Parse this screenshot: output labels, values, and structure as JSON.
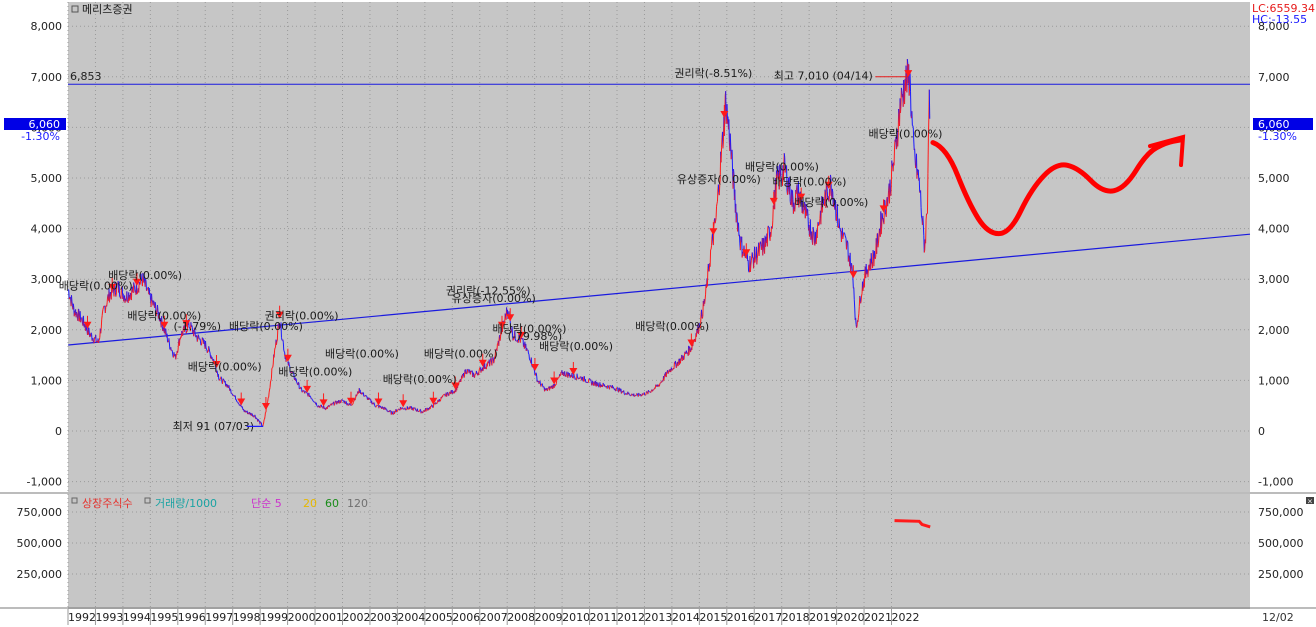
{
  "panel_title": "메리츠증권",
  "readouts": {
    "lc": "LC:6559.34",
    "hc": "HC:-13.55"
  },
  "current_price": {
    "value": "6,060",
    "change": "-1.30%"
  },
  "colors": {
    "price_up": "#ff1a1a",
    "price_down": "#1a1aff",
    "trendline": "#1a1adf",
    "marker": "#ff1a1a",
    "current_box": "#0000e6",
    "overlay": "#ff0000"
  },
  "volume_panel": {
    "legend": [
      {
        "text": "상장주식수",
        "color": "#e6322d"
      },
      {
        "text": "거래량/1000",
        "color": "#1aa3a3"
      },
      {
        "text": "단순 5",
        "color": "#cc33cc"
      },
      {
        "text": "20",
        "color": "#e6b800"
      },
      {
        "text": "60",
        "color": "#1a8c1a"
      },
      {
        "text": "120",
        "color": "#707070"
      }
    ]
  },
  "chart_data": [
    {
      "type": "line",
      "title": "메리츠증권",
      "y_ticks": [
        "8,000",
        "7,000",
        "6,000",
        "5,000",
        "4,000",
        "3,000",
        "2,000",
        "1,000",
        "0",
        "-1,000"
      ],
      "y_tick_values": [
        8000,
        7000,
        6000,
        5000,
        4000,
        3000,
        2000,
        1000,
        0,
        -1000
      ],
      "x_ticks": [
        "1992",
        "1993",
        "1994",
        "1995",
        "1996",
        "1997",
        "1998",
        "1999",
        "2000",
        "2001",
        "2002",
        "2003",
        "2004",
        "2005",
        "2006",
        "2007",
        "2008",
        "2009",
        "2010",
        "2011",
        "2012",
        "2013",
        "2014",
        "2015",
        "2016",
        "2017",
        "2018",
        "2019",
        "2020",
        "2021",
        "2022"
      ],
      "x_end_label": "12/02",
      "ylim": [
        -1000,
        8400
      ],
      "grid": true,
      "horizontal_line": {
        "value": 6853,
        "label": "6,853"
      },
      "trendline": {
        "from": [
          1991.5,
          1700
        ],
        "to": [
          2034,
          3890
        ]
      },
      "max_label": "최고 7,010 (04/14)",
      "min_label": "최저 91 (07/03)",
      "price_series": [
        [
          1991.5,
          2800
        ],
        [
          1991.7,
          2400
        ],
        [
          1992.0,
          2200
        ],
        [
          1992.3,
          1900
        ],
        [
          1992.6,
          1750
        ],
        [
          1992.8,
          2400
        ],
        [
          1993.0,
          2700
        ],
        [
          1993.3,
          2850
        ],
        [
          1993.6,
          2650
        ],
        [
          1994.0,
          2850
        ],
        [
          1994.2,
          3000
        ],
        [
          1994.5,
          2600
        ],
        [
          1994.8,
          2300
        ],
        [
          1995.0,
          2000
        ],
        [
          1995.2,
          1700
        ],
        [
          1995.4,
          1450
        ],
        [
          1995.6,
          1900
        ],
        [
          1995.9,
          2100
        ],
        [
          1996.2,
          1850
        ],
        [
          1996.5,
          1700
        ],
        [
          1996.8,
          1400
        ],
        [
          1997.0,
          1050
        ],
        [
          1997.3,
          900
        ],
        [
          1997.6,
          650
        ],
        [
          1997.9,
          400
        ],
        [
          1998.1,
          350
        ],
        [
          1998.3,
          300
        ],
        [
          1998.5,
          150
        ],
        [
          1998.6,
          91
        ],
        [
          1998.8,
          700
        ],
        [
          1999.0,
          1500
        ],
        [
          1999.2,
          2200
        ],
        [
          1999.4,
          1500
        ],
        [
          1999.6,
          1200
        ],
        [
          1999.8,
          1000
        ],
        [
          2000.0,
          800
        ],
        [
          2000.3,
          700
        ],
        [
          2000.6,
          500
        ],
        [
          2000.9,
          450
        ],
        [
          2001.2,
          550
        ],
        [
          2001.5,
          600
        ],
        [
          2001.8,
          500
        ],
        [
          2002.1,
          800
        ],
        [
          2002.4,
          650
        ],
        [
          2002.7,
          500
        ],
        [
          2003.0,
          450
        ],
        [
          2003.3,
          350
        ],
        [
          2003.6,
          450
        ],
        [
          2004.0,
          450
        ],
        [
          2004.4,
          380
        ],
        [
          2004.8,
          500
        ],
        [
          2005.2,
          700
        ],
        [
          2005.6,
          800
        ],
        [
          2006.0,
          1200
        ],
        [
          2006.3,
          1100
        ],
        [
          2006.6,
          1250
        ],
        [
          2007.0,
          1400
        ],
        [
          2007.3,
          2000
        ],
        [
          2007.5,
          2400
        ],
        [
          2007.7,
          1900
        ],
        [
          2008.0,
          1800
        ],
        [
          2008.3,
          1500
        ],
        [
          2008.6,
          1000
        ],
        [
          2008.9,
          800
        ],
        [
          2009.2,
          900
        ],
        [
          2009.5,
          1150
        ],
        [
          2009.8,
          1100
        ],
        [
          2010.2,
          1050
        ],
        [
          2010.6,
          950
        ],
        [
          2011.0,
          900
        ],
        [
          2011.4,
          850
        ],
        [
          2011.8,
          750
        ],
        [
          2012.2,
          700
        ],
        [
          2012.6,
          750
        ],
        [
          2013.0,
          900
        ],
        [
          2013.4,
          1200
        ],
        [
          2013.8,
          1400
        ],
        [
          2014.2,
          1650
        ],
        [
          2014.5,
          2100
        ],
        [
          2014.7,
          2600
        ],
        [
          2014.9,
          3500
        ],
        [
          2015.1,
          4200
        ],
        [
          2015.3,
          5500
        ],
        [
          2015.45,
          6500
        ],
        [
          2015.6,
          5800
        ],
        [
          2015.8,
          4500
        ],
        [
          2016.0,
          3700
        ],
        [
          2016.3,
          3300
        ],
        [
          2016.6,
          3500
        ],
        [
          2016.9,
          3700
        ],
        [
          2017.1,
          4000
        ],
        [
          2017.3,
          4900
        ],
        [
          2017.6,
          5200
        ],
        [
          2017.9,
          4500
        ],
        [
          2018.1,
          4700
        ],
        [
          2018.4,
          4200
        ],
        [
          2018.7,
          3800
        ],
        [
          2019.0,
          4500
        ],
        [
          2019.3,
          4900
        ],
        [
          2019.6,
          4000
        ],
        [
          2019.9,
          3600
        ],
        [
          2020.1,
          3000
        ],
        [
          2020.2,
          2000
        ],
        [
          2020.4,
          2800
        ],
        [
          2020.6,
          3200
        ],
        [
          2020.9,
          3500
        ],
        [
          2021.1,
          4100
        ],
        [
          2021.4,
          4700
        ],
        [
          2021.6,
          5400
        ],
        [
          2021.8,
          6400
        ],
        [
          2022.0,
          6900
        ],
        [
          2022.15,
          7010
        ],
        [
          2022.3,
          5500
        ],
        [
          2022.5,
          4900
        ],
        [
          2022.7,
          3600
        ],
        [
          2022.8,
          4500
        ],
        [
          2022.85,
          6550
        ],
        [
          2022.9,
          6060
        ]
      ],
      "annotations": [
        {
          "text": "배당락(0.00%)",
          "x": 1992.5,
          "value": 2800
        },
        {
          "text": "배당락(0.00%)",
          "x": 1994.3,
          "value": 3000
        },
        {
          "text": "배당락(0.00%)",
          "x": 1995.0,
          "value": 2200
        },
        {
          "text": "(-1.79%)",
          "x": 1996.2,
          "value": 2000
        },
        {
          "text": "배당락(0.00%)",
          "x": 1997.2,
          "value": 1200
        },
        {
          "text": "배당락(0.00%)",
          "x": 1998.7,
          "value": 2000
        },
        {
          "text": "권리락(0.00%)",
          "x": 2000.0,
          "value": 2200
        },
        {
          "text": "배당락(0.00%)",
          "x": 2000.5,
          "value": 1100
        },
        {
          "text": "배당락(0.00%)",
          "x": 2002.2,
          "value": 1450
        },
        {
          "text": "배당락(0.00%)",
          "x": 2004.3,
          "value": 950
        },
        {
          "text": "배당락(0.00%)",
          "x": 2005.8,
          "value": 1450
        },
        {
          "text": "권리락(-12.55%)",
          "x": 2006.8,
          "value": 2700
        },
        {
          "text": "유상증자(0.00%)",
          "x": 2007.0,
          "value": 2550
        },
        {
          "text": "배당락(0.00%)",
          "x": 2008.3,
          "value": 1950
        },
        {
          "text": "(-79.98%)",
          "x": 2008.5,
          "value": 1800
        },
        {
          "text": "배당락(0.00%)",
          "x": 2010.0,
          "value": 1600
        },
        {
          "text": "배당락(0.00%)",
          "x": 2013.5,
          "value": 2000
        },
        {
          "text": "권리락(-8.51%)",
          "x": 2015.0,
          "value": 7000
        },
        {
          "text": "유상증자(0.00%)",
          "x": 2015.2,
          "value": 4900
        },
        {
          "text": "배당락(0.00%)",
          "x": 2017.5,
          "value": 5150
        },
        {
          "text": "배당락(0.00%)",
          "x": 2018.5,
          "value": 4850
        },
        {
          "text": "배당락(0.00%)",
          "x": 2019.3,
          "value": 4450
        },
        {
          "text": "배당락(0.00%)",
          "x": 2022.0,
          "value": 5800
        }
      ],
      "event_markers": [
        1992.2,
        1993.1,
        1994.0,
        1995.0,
        1995.8,
        1996.9,
        1997.8,
        1998.7,
        1999.2,
        1999.5,
        2000.2,
        2000.8,
        2001.8,
        2002.8,
        2003.7,
        2004.8,
        2005.6,
        2006.6,
        2007.3,
        2007.6,
        2008.0,
        2008.5,
        2009.2,
        2009.9,
        2014.2,
        2015.0,
        2015.4,
        2016.2,
        2017.2,
        2018.2,
        2019.2,
        2020.1,
        2021.2,
        2022.1
      ]
    },
    {
      "type": "area",
      "title": "상장주식수",
      "y_ticks": [
        "750,000",
        "500,000",
        "250,000"
      ],
      "y_tick_values": [
        750000,
        500000,
        250000
      ],
      "ylim": [
        0,
        850000
      ],
      "series": [
        {
          "name": "상장주식수",
          "x": [
            2021.6,
            2022.5,
            2022.6,
            2022.9
          ],
          "values": [
            680000,
            675000,
            650000,
            630000
          ]
        }
      ]
    }
  ],
  "overlay": {
    "kind": "hand-drawn projection",
    "path_points": [
      [
        2023.0,
        5700
      ],
      [
        2023.5,
        5600
      ],
      [
        2024.3,
        4500
      ],
      [
        2025.0,
        3900
      ],
      [
        2025.8,
        3900
      ],
      [
        2026.6,
        4800
      ],
      [
        2027.5,
        5300
      ],
      [
        2028.3,
        5200
      ],
      [
        2029.2,
        4700
      ],
      [
        2030.0,
        4800
      ],
      [
        2030.8,
        5500
      ],
      [
        2031.5,
        5700
      ],
      [
        2032.0,
        5750
      ]
    ]
  }
}
